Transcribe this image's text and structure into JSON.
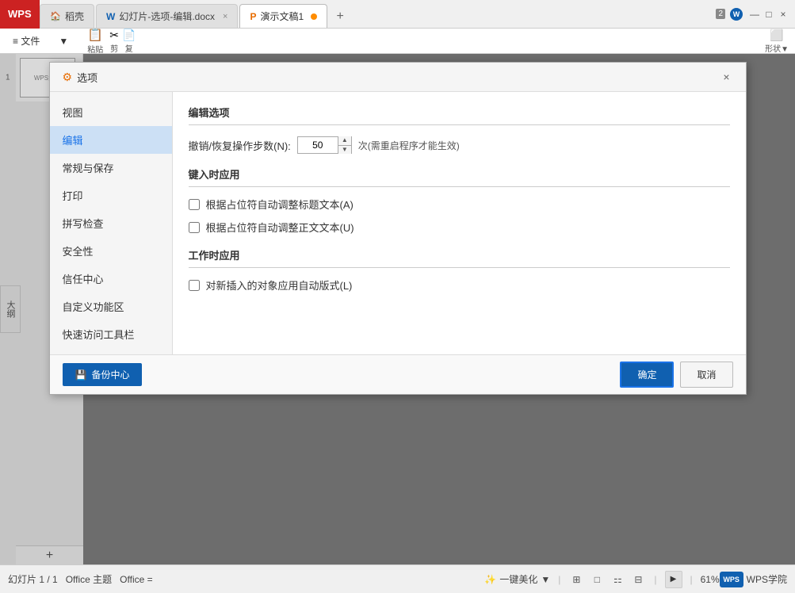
{
  "titlebar": {
    "wps_label": "WPS",
    "tabs": [
      {
        "id": "tab-daoke",
        "label": "稻壳",
        "icon": "🏠",
        "active": false,
        "closable": false
      },
      {
        "id": "tab-doc",
        "label": "幻灯片-选项-编辑.docx",
        "icon": "📝",
        "active": false,
        "closable": true
      },
      {
        "id": "tab-present",
        "label": "演示文稿1",
        "icon": "📊",
        "active": true,
        "closable": false
      }
    ],
    "new_tab_label": "+",
    "badge_num": "2",
    "close_label": "×"
  },
  "ribbon": {
    "menu_items": [
      "≡ 文件",
      "▼"
    ]
  },
  "outline_tab": "大纲",
  "slide_number": "1",
  "slide_preview_text": "WPS演示",
  "dialog": {
    "title": "选项",
    "title_icon": "⚙",
    "close_label": "×",
    "sidebar": {
      "items": [
        {
          "id": "view",
          "label": "视图",
          "active": false
        },
        {
          "id": "edit",
          "label": "编辑",
          "active": true
        },
        {
          "id": "general",
          "label": "常规与保存",
          "active": false
        },
        {
          "id": "print",
          "label": "打印",
          "active": false
        },
        {
          "id": "spell",
          "label": "拼写检查",
          "active": false
        },
        {
          "id": "security",
          "label": "安全性",
          "active": false
        },
        {
          "id": "trust",
          "label": "信任中心",
          "active": false
        },
        {
          "id": "customize",
          "label": "自定义功能区",
          "active": false
        },
        {
          "id": "quickaccess",
          "label": "快速访问工具栏",
          "active": false
        }
      ]
    },
    "content": {
      "main_section_title": "编辑选项",
      "undo_label": "撤销/恢复操作步数(N):",
      "undo_value": "50",
      "undo_suffix": "次(需重启程序才能生效)",
      "type_apply_section": "键入时应用",
      "checkbox1_label": "根据占位符自动调整标题文本(A)",
      "checkbox1_checked": false,
      "checkbox2_label": "根据占位符自动调整正文文本(U)",
      "checkbox2_checked": false,
      "work_apply_section": "工作时应用",
      "checkbox3_label": "对新插入的对象应用自动版式(L)",
      "checkbox3_checked": false
    },
    "footer": {
      "backup_btn_icon": "💾",
      "backup_btn_label": "备份中心",
      "ok_btn_label": "确定",
      "cancel_btn_label": "取消"
    }
  },
  "statusbar": {
    "slide_info": "幻灯片 1 / 1",
    "theme_label": "Office 主题",
    "office_eq": "Office =",
    "beautify_label": "一键美化",
    "zoom_label": "61%",
    "wps_academy_label": "WPS学院"
  }
}
